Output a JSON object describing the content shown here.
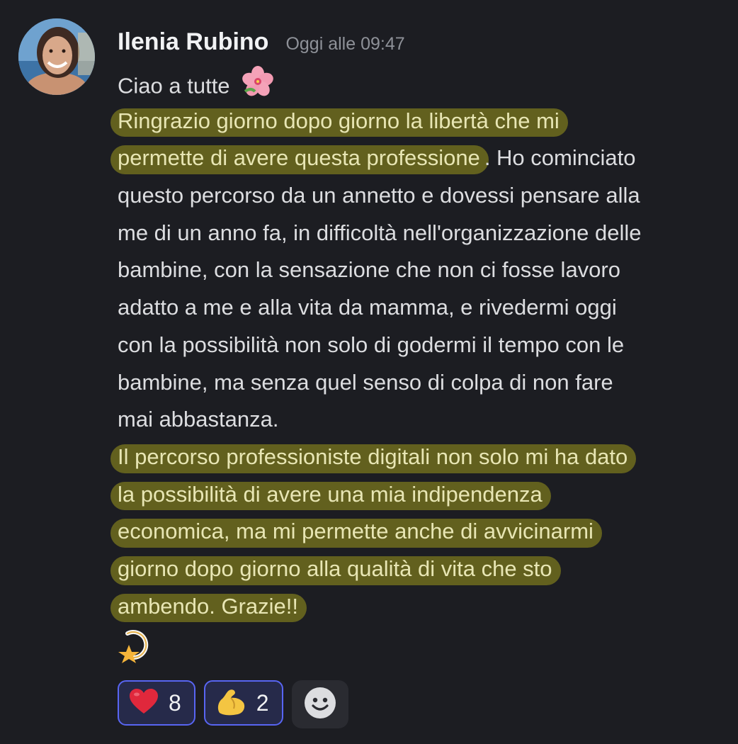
{
  "message": {
    "author": "Ilenia Rubino",
    "timestamp": "Oggi alle 09:47",
    "greeting": "Ciao a tutte",
    "greeting_emoji": "hibiscus-icon",
    "lines": [
      {
        "hl": "Ringrazio giorno dopo giorno la libertà che mi",
        "rest": ""
      },
      {
        "hl": "permette di avere questa professione",
        "rest": ". Ho cominciato"
      },
      {
        "hl": "",
        "rest": "questo percorso da un annetto e dovessi pensare alla"
      },
      {
        "hl": "",
        "rest": "me di un anno fa, in difficoltà nell'organizzazione delle"
      },
      {
        "hl": "",
        "rest": "bambine, con la sensazione che non ci fosse lavoro"
      },
      {
        "hl": "",
        "rest": "adatto a me e alla vita da mamma, e rivedermi oggi"
      },
      {
        "hl": "",
        "rest": "con la possibilità non solo di godermi il tempo con le"
      },
      {
        "hl": "",
        "rest": "bambine, ma senza quel senso di colpa di non fare"
      },
      {
        "hl": "",
        "rest": "mai abbastanza."
      },
      {
        "hl": "Il percorso professioniste digitali non solo mi ha dato",
        "rest": ""
      },
      {
        "hl": "la possibilità di avere una mia indipendenza",
        "rest": ""
      },
      {
        "hl": "economica, ma mi permette anche di avvicinarmi",
        "rest": ""
      },
      {
        "hl": "giorno dopo giorno alla qualità di vita che sto",
        "rest": ""
      },
      {
        "hl": "ambendo. Grazie!!",
        "rest": ""
      }
    ],
    "closing_emoji": "dizzy-star-icon",
    "highlight_color": "#68661e"
  },
  "reactions": [
    {
      "emoji": "red-heart-icon",
      "count": "8"
    },
    {
      "emoji": "flexed-biceps-icon",
      "count": "2"
    }
  ],
  "add_reaction_icon": "smiley-add-icon",
  "colors": {
    "background": "#1c1d22",
    "text": "#dcdde0",
    "timestamp": "#8e9198",
    "reaction_border": "#5865f2",
    "reaction_bg": "#262a4a"
  }
}
